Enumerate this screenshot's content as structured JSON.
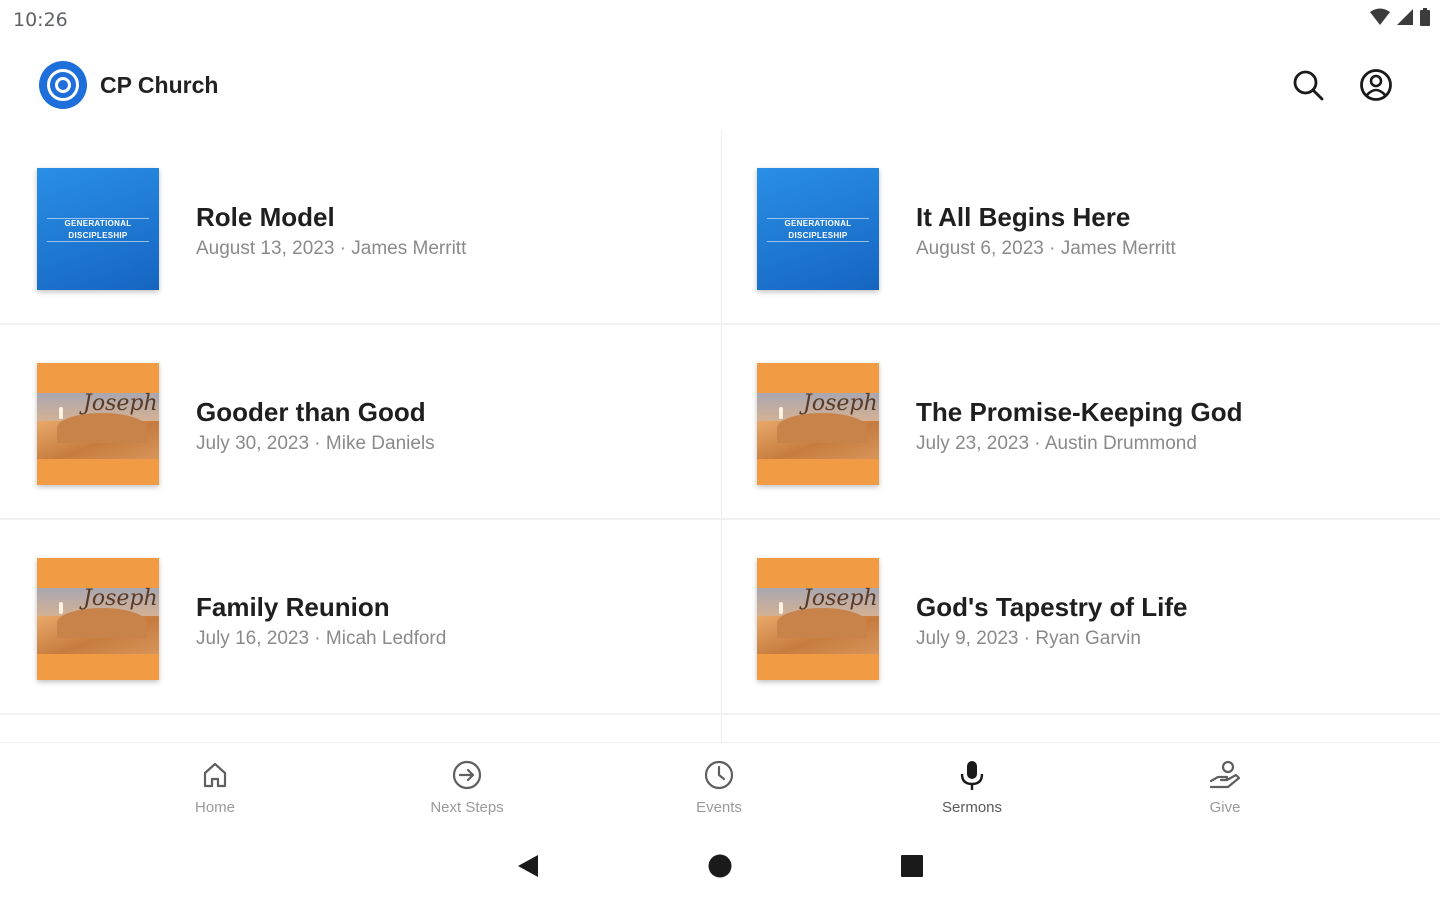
{
  "status_bar": {
    "time": "10:26"
  },
  "app_bar": {
    "title": "CP Church"
  },
  "sermons": [
    {
      "title": "Role Model",
      "meta": "August 13, 2023 · James Merritt",
      "artwork": "generational-discipleship",
      "artwork_text": [
        "GENERATIONAL",
        "DISCIPLESHIP"
      ]
    },
    {
      "title": "It All Begins Here",
      "meta": "August 6, 2023 · James Merritt",
      "artwork": "generational-discipleship",
      "artwork_text": [
        "GENERATIONAL",
        "DISCIPLESHIP"
      ]
    },
    {
      "title": "Gooder than Good",
      "meta": "July 30, 2023 · Mike Daniels",
      "artwork": "joseph-desert",
      "artwork_text": [
        "Joseph"
      ]
    },
    {
      "title": "The Promise-Keeping God",
      "meta": "July 23, 2023 · Austin Drummond",
      "artwork": "joseph-desert",
      "artwork_text": [
        "Joseph"
      ]
    },
    {
      "title": "Family Reunion",
      "meta": "July 16, 2023 · Micah Ledford",
      "artwork": "joseph-desert",
      "artwork_text": [
        "Joseph"
      ]
    },
    {
      "title": "God's Tapestry of Life",
      "meta": "July 9, 2023 · Ryan Garvin",
      "artwork": "joseph-desert",
      "artwork_text": [
        "Joseph"
      ]
    }
  ],
  "bottom_nav": {
    "items": [
      {
        "label": "Home",
        "icon": "home-icon"
      },
      {
        "label": "Next Steps",
        "icon": "arrow-circle-icon"
      },
      {
        "label": "Events",
        "icon": "clock-icon"
      },
      {
        "label": "Sermons",
        "icon": "microphone-icon"
      },
      {
        "label": "Give",
        "icon": "give-hand-icon"
      }
    ],
    "active": "Sermons"
  },
  "colors": {
    "brand_blue": "#1e6fd9",
    "desert_orange": "#f29b45",
    "meta_gray": "#8a8a8a"
  }
}
